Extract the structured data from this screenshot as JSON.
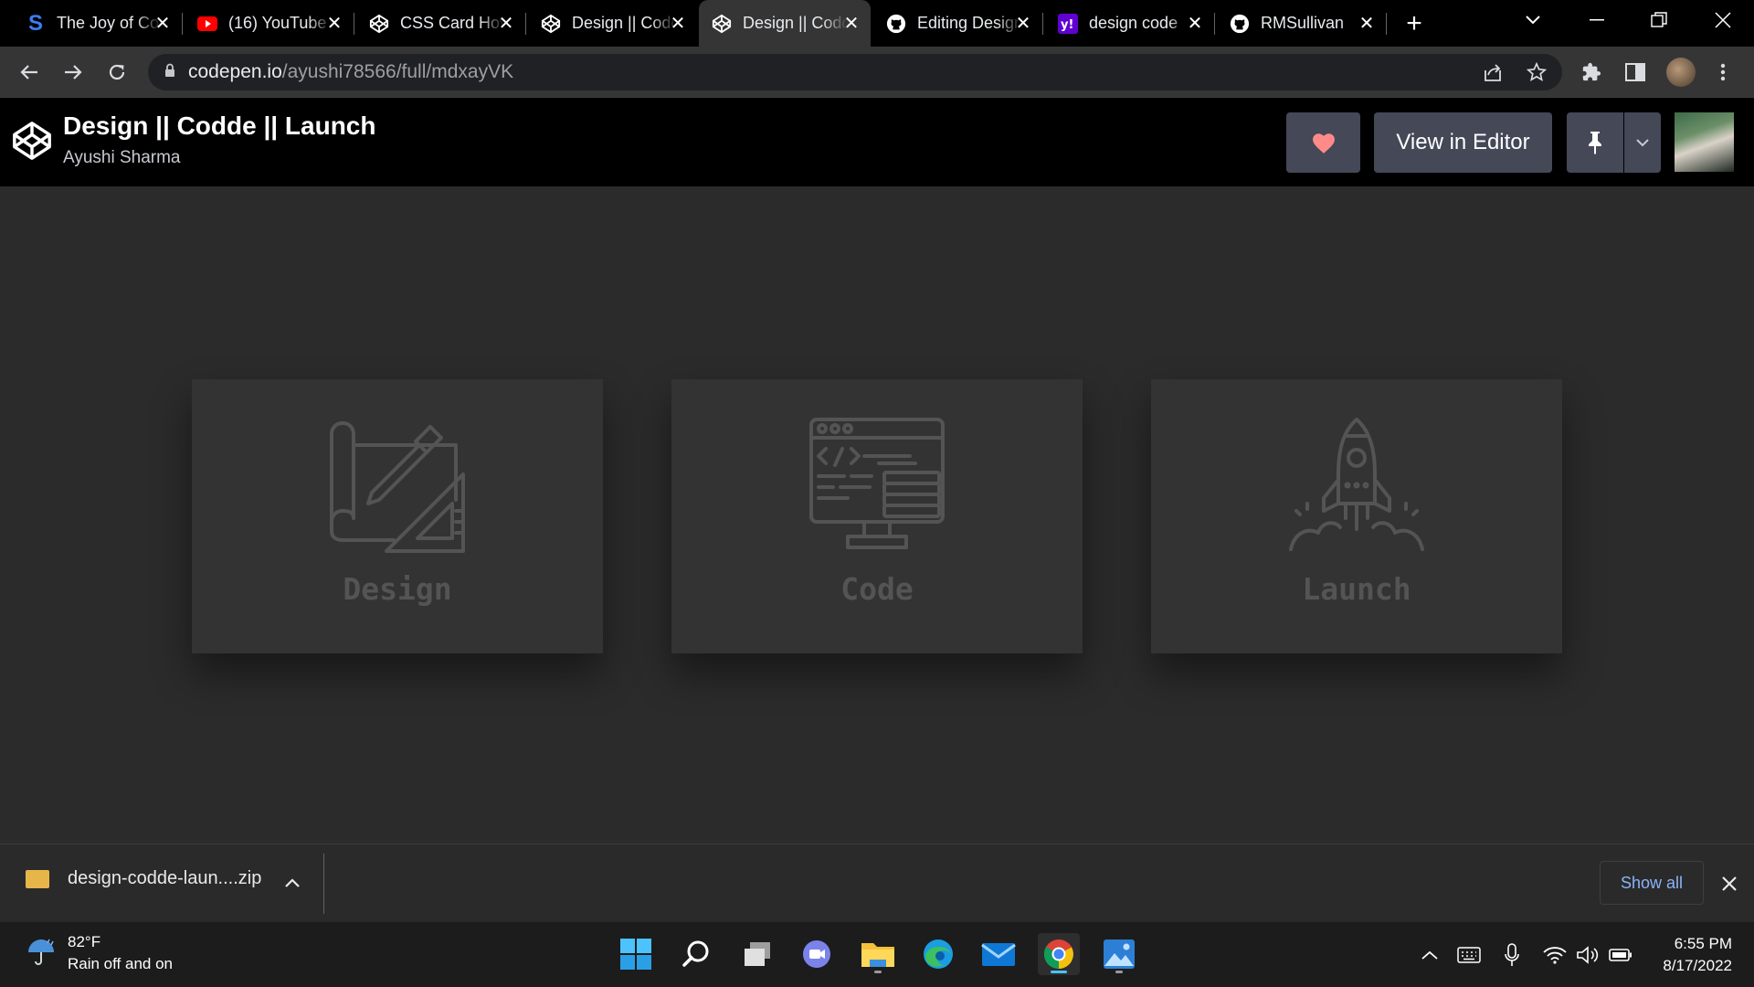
{
  "browser": {
    "tabs": [
      {
        "title": "The Joy of Code",
        "favicon": "s-icon",
        "active": false
      },
      {
        "title": "(16) YouTube",
        "favicon": "youtube-icon",
        "active": false
      },
      {
        "title": "CSS Card Hover",
        "favicon": "codepen-icon",
        "active": false
      },
      {
        "title": "Design || Codde",
        "favicon": "codepen-icon",
        "active": false
      },
      {
        "title": "Design || Codde",
        "favicon": "codepen-icon",
        "active": true
      },
      {
        "title": "Editing Design",
        "favicon": "github-icon",
        "active": false
      },
      {
        "title": "design code",
        "favicon": "yahoo-icon",
        "active": false
      },
      {
        "title": "RMSullivan",
        "favicon": "github-icon",
        "active": false
      }
    ],
    "url_host": "codepen.io",
    "url_path": "/ayushi78566/full/mdxayVK"
  },
  "codepen": {
    "title": "Design || Codde || Launch",
    "author": "Ayushi Sharma",
    "view_in_editor": "View in Editor"
  },
  "cards": [
    {
      "label": "Design",
      "icon": "design-blueprint-icon"
    },
    {
      "label": "Code",
      "icon": "code-monitor-icon"
    },
    {
      "label": "Launch",
      "icon": "rocket-launch-icon"
    }
  ],
  "downloads": {
    "file": "design-codde-laun....zip",
    "show_all": "Show all"
  },
  "taskbar": {
    "temperature": "82°F",
    "weather": "Rain off and on",
    "time": "6:55 PM",
    "date": "8/17/2022"
  },
  "colors": {
    "page_bg": "#2b2b2b",
    "card_bg": "#333333",
    "card_text": "#545454",
    "header_bg": "#000000",
    "button_bg": "#444857",
    "heart": "#ff8a8a",
    "link": "#8ab4f8"
  }
}
